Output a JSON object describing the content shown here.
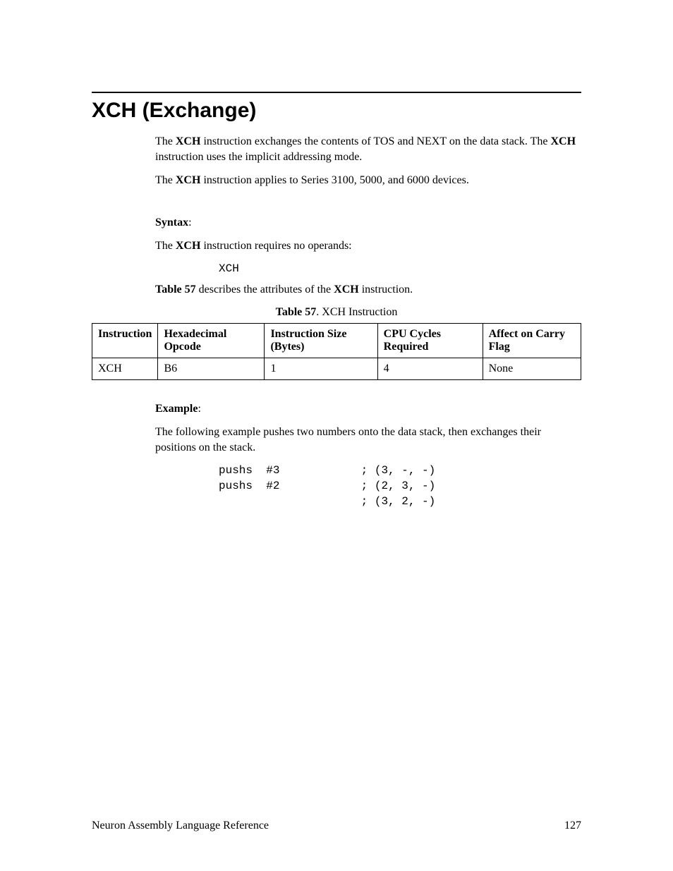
{
  "heading": "XCH (Exchange)",
  "para1_pre": "The ",
  "para1_b1": "XCH",
  "para1_mid": " instruction exchanges the contents of TOS and NEXT on the data stack.  The ",
  "para1_b2": "XCH",
  "para1_post": " instruction uses the implicit addressing mode.",
  "para2_pre": "The ",
  "para2_b": "XCH",
  "para2_post": " instruction applies to Series 3100, 5000, and 6000 devices.",
  "syntax_label": "Syntax",
  "syntax_colon": ":",
  "syntax_line_pre": "The ",
  "syntax_line_b": "XCH",
  "syntax_line_post": " instruction requires no operands:",
  "syntax_code": "XCH",
  "table_ref_pre": "Table 57",
  "table_ref_mid": " describes the attributes of the ",
  "table_ref_b": "XCH",
  "table_ref_post": " instruction.",
  "table_caption_b": "Table 57",
  "table_caption_rest": ". XCH Instruction",
  "table": {
    "headers": [
      "Instruction",
      "Hexadecimal Opcode",
      "Instruction Size (Bytes)",
      "CPU Cycles Required",
      "Affect on Carry Flag"
    ],
    "row": [
      "XCH",
      "B6",
      "1",
      "4",
      "None"
    ]
  },
  "example_label": "Example",
  "example_colon": ":",
  "example_text": "The following example pushes two numbers onto the data stack, then exchanges their positions on the stack.",
  "example_code": "pushs  #3            ; (3, -, -)\npushs  #2            ; (2, 3, -)\n                     ; (3, 2, -)",
  "footer_left": "Neuron Assembly Language Reference",
  "footer_right": "127"
}
